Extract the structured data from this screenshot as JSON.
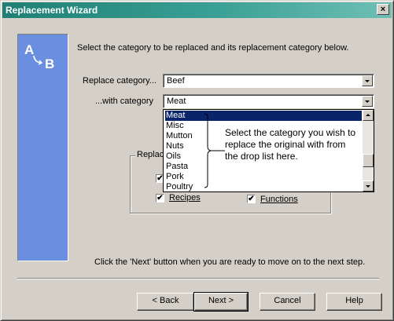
{
  "window": {
    "title": "Replacement Wizard",
    "close_glyph": "×"
  },
  "sidebar": {
    "logo_a": "A",
    "logo_b": "B",
    "logo_icon": "a-to-b-replace-icon"
  },
  "instruction": "Select the category to be replaced and its replacement category below.",
  "replace": {
    "label": "Replace category...",
    "value": "Beef"
  },
  "with": {
    "label": "...with category",
    "value": "Meat"
  },
  "dropdown": {
    "items": [
      "Meat",
      "Misc",
      "Mutton",
      "Nuts",
      "Oils",
      "Pasta",
      "Pork",
      "Poultry"
    ],
    "selected": "Meat"
  },
  "callout": "Select the category you wish to replace the original with from the drop list here.",
  "group": {
    "label_visible": "Replac"
  },
  "checks": {
    "recipes_label": "Recipes",
    "functions_label": "Functions",
    "check_glyph": "✔"
  },
  "footer_text": "Click the 'Next' button when you are ready to move on to the next step.",
  "buttons": {
    "back": "< Back",
    "next": "Next >",
    "cancel": "Cancel",
    "help": "Help"
  }
}
